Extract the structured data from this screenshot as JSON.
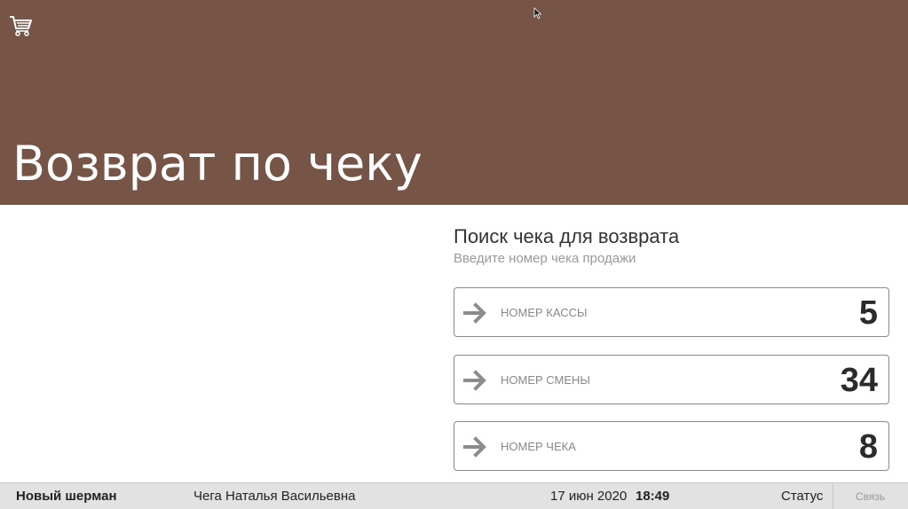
{
  "header": {
    "title": "Возврат по чеку",
    "background_color": "#765446",
    "icon": "cart-icon"
  },
  "search": {
    "title": "Поиск чека для возврата",
    "subtitle": "Введите номер чека продажи",
    "fields": [
      {
        "label": "НОМЕР КАССЫ",
        "value": "5",
        "icon": "arrow-right-icon"
      },
      {
        "label": "НОМЕР СМЕНЫ",
        "value": "34",
        "icon": "arrow-right-icon"
      },
      {
        "label": "НОМЕР ЧЕКА",
        "value": "8",
        "icon": "arrow-right-icon"
      }
    ]
  },
  "status_bar": {
    "store": "Новый шерман",
    "user": "Чега Наталья Васильевна",
    "date": "17 июн 2020",
    "time": "18:49",
    "status_label": "Статус",
    "connection_label": "Связь"
  }
}
